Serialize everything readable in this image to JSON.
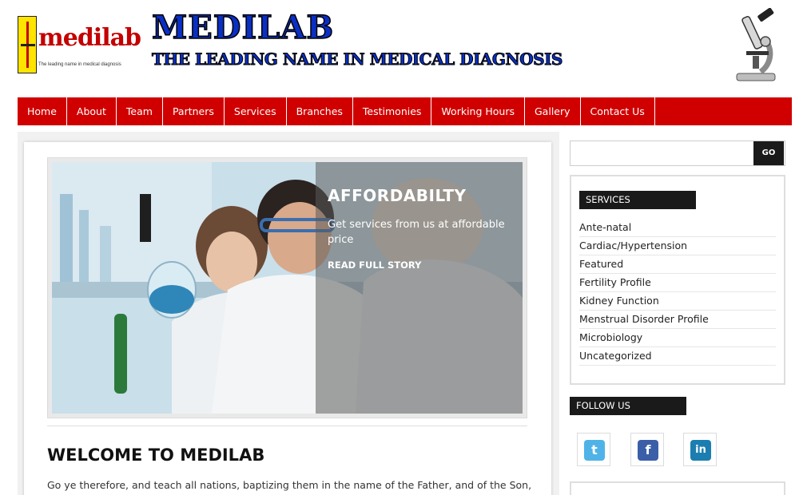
{
  "header": {
    "logo_name": "medilab",
    "logo_tagline": "The leading name in medical diagnosis",
    "title": "MEDILAB",
    "subtitle": "THE LEADING NAME IN MEDICAL DIAGNOSIS"
  },
  "nav": {
    "items": [
      {
        "label": "Home"
      },
      {
        "label": "About"
      },
      {
        "label": "Team"
      },
      {
        "label": "Partners"
      },
      {
        "label": "Services"
      },
      {
        "label": "Branches"
      },
      {
        "label": "Testimonies"
      },
      {
        "label": "Working Hours"
      },
      {
        "label": "Gallery"
      },
      {
        "label": "Contact Us"
      }
    ]
  },
  "slider": {
    "title": "AFFORDABILTY",
    "text": "Get services from us at affordable price",
    "link": "READ FULL STORY"
  },
  "main": {
    "heading": "WELCOME TO MEDILAB",
    "intro": "Go ye therefore, and teach all nations, baptizing them in the name of the Father, and of the Son, and"
  },
  "sidebar": {
    "search": {
      "placeholder": "",
      "button": "GO"
    },
    "services_heading": "SERVICES",
    "services": [
      "Ante-natal",
      "Cardiac/Hypertension",
      "Featured",
      "Fertility Profile",
      "Kidney Function",
      "Menstrual Disorder Profile",
      "Microbiology",
      "Uncategorized"
    ],
    "follow_heading": "FOLLOW US",
    "social": [
      {
        "name": "twitter",
        "glyph": "t",
        "color": "#4fb3e8"
      },
      {
        "name": "facebook",
        "glyph": "f",
        "color": "#3b5ea8"
      },
      {
        "name": "linkedin",
        "glyph": "in",
        "color": "#1c7eb0"
      }
    ]
  },
  "colors": {
    "nav_red": "#d00000",
    "brand_blue": "#0a2fc4",
    "dark": "#1a1a1a"
  }
}
